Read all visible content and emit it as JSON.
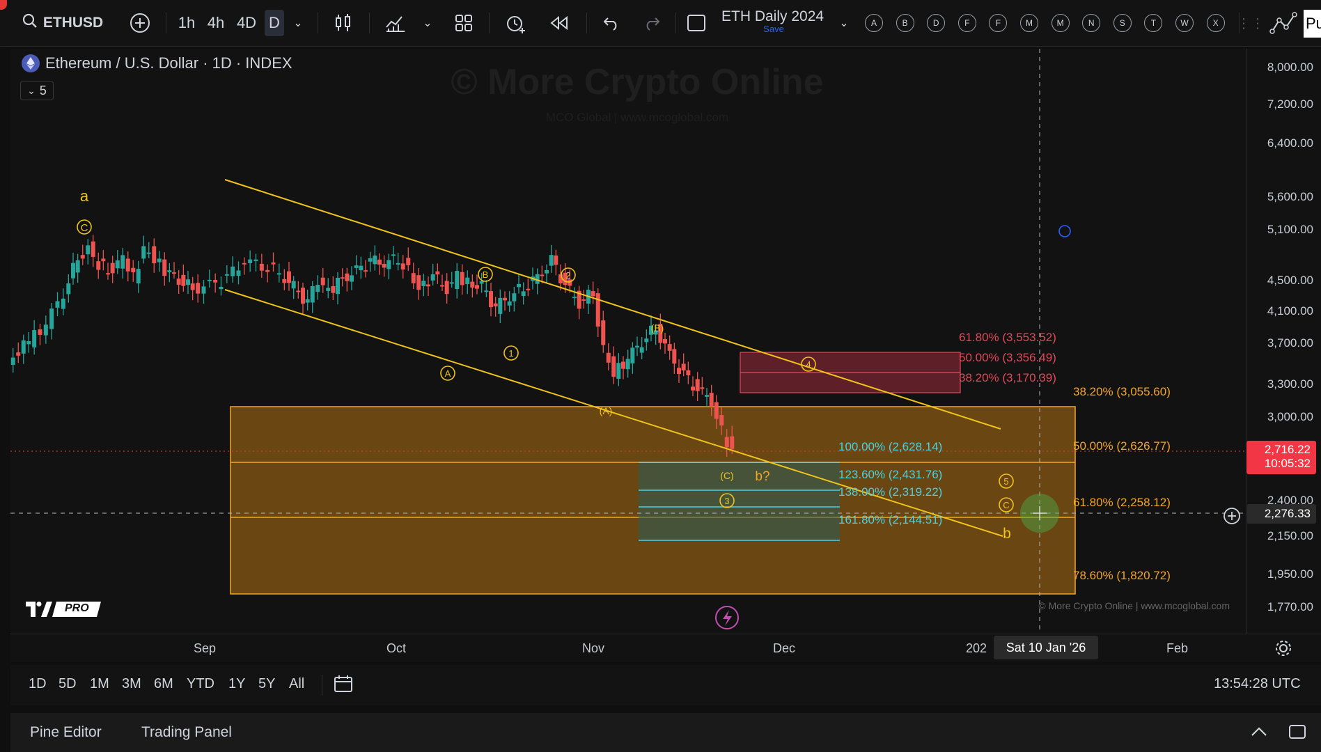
{
  "toolbar": {
    "symbol": "ETHUSD",
    "intervals": [
      "1h",
      "4h",
      "4D",
      "D"
    ],
    "layout_name": "ETH Daily 2024",
    "save_label": "Save",
    "circle_buttons": [
      "A",
      "B",
      "D",
      "F",
      "F",
      "M",
      "M",
      "N",
      "S",
      "T",
      "W",
      "X"
    ],
    "right_partial": "Pu"
  },
  "chart_header": {
    "title": "Ethereum / U.S. Dollar · 1D · INDEX",
    "indicator_count": "5"
  },
  "watermark": {
    "main": "© More Crypto Online",
    "sub": "MCO Global   |   www.mcoglobal.com",
    "bottom": "© More Crypto Online   |   www.mcoglobal.com"
  },
  "price_axis": {
    "labels": [
      "8,000.00",
      "7,200.00",
      "6,400.00",
      "5,600.00",
      "5,100.00",
      "4,500.00",
      "4,100.00",
      "3,700.00",
      "3,300.00",
      "3,000.00",
      "2,400.00",
      "2,150.00",
      "1,950.00",
      "1,770.00"
    ],
    "current_price": "2,716.22",
    "countdown": "10:05:32",
    "crosshair_price": "2,276.33"
  },
  "time_axis": {
    "labels": [
      "Sep",
      "Oct",
      "Nov",
      "Dec",
      "202",
      "Feb"
    ],
    "crosshair_date": "Sat 10 Jan '26"
  },
  "range_bar": {
    "ranges": [
      "1D",
      "5D",
      "1M",
      "3M",
      "6M",
      "YTD",
      "1Y",
      "5Y",
      "All"
    ],
    "clock": "13:54:28 UTC"
  },
  "bottom_bar": {
    "tabs": [
      "Pine Editor",
      "Trading Panel"
    ]
  },
  "fib_upper": [
    "61.80% (3,553.52)",
    "50.00% (3,356.49)",
    "38.20% (3,170.39)"
  ],
  "fib_orange": [
    "38.20% (3,055.60)",
    "50.00% (2,626.77)",
    "61.80% (2,258.12)",
    "78.60% (1,820.72)"
  ],
  "fib_cyan": [
    "100.00% (2,628.14)",
    "123.60% (2,431.76)",
    "138.00% (2,319.22)",
    "161.80% (2,144.51)"
  ],
  "wave_labels": {
    "a": "a",
    "C_top": "C",
    "A": "A",
    "B": "B",
    "one": "1",
    "two": "2",
    "paren_A": "(A)",
    "paren_B": "(B)",
    "paren_C": "(C)",
    "three": "3",
    "four": "4",
    "five": "5",
    "C_right": "C",
    "b_q": "b?",
    "b": "b"
  },
  "logo": {
    "pro": "PRO"
  },
  "colors": {
    "up": "#26a69a",
    "down": "#ef5350",
    "accent": "#f0c419",
    "orange_zone": "#f5a623",
    "red_zone": "#e04a5a",
    "cyan": "#4dd0e1",
    "current_price_bg": "#f23645"
  }
}
